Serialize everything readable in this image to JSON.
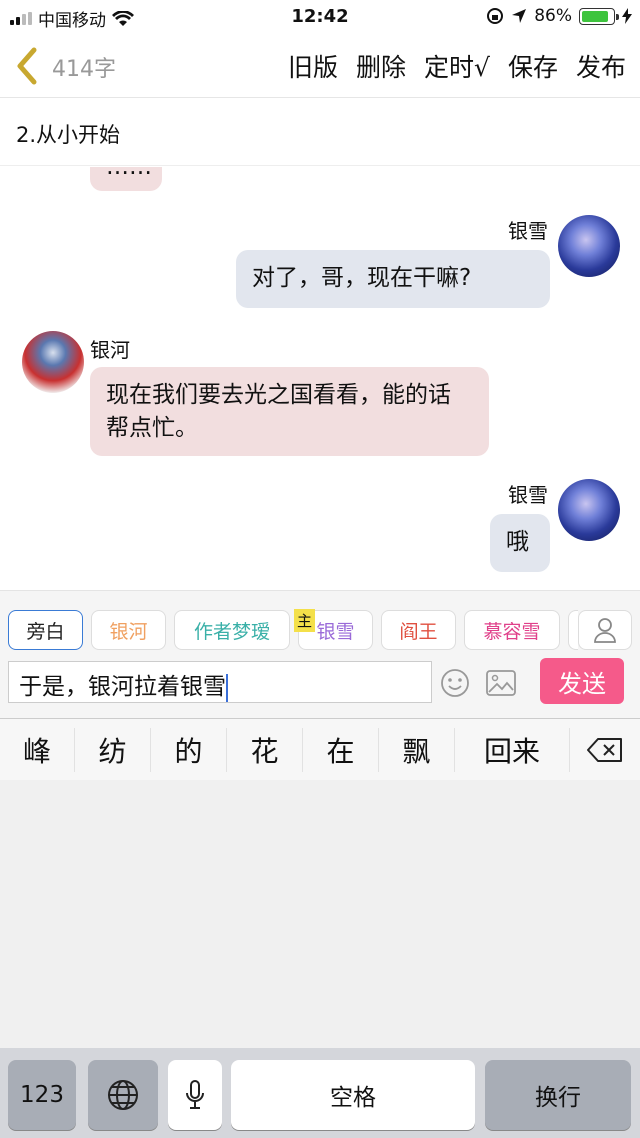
{
  "status": {
    "carrier": "中国移动",
    "time": "12:42",
    "battery": "86%",
    "battery_level": 0.86
  },
  "nav": {
    "wordcount": "414字",
    "actions": [
      "旧版",
      "删除",
      "定时√",
      "保存",
      "发布"
    ]
  },
  "chapter_title": "2.从小开始",
  "chat": [
    {
      "side": "left",
      "text": "……"
    },
    {
      "side": "right",
      "name": "银雪",
      "text": "对了，哥，现在干嘛?"
    },
    {
      "side": "left",
      "name": "银河",
      "text": "现在我们要去光之国看看，能的话帮点忙。"
    },
    {
      "side": "right",
      "name": "银雪",
      "text": "哦"
    }
  ],
  "roles": [
    {
      "label": "旁白",
      "color": "#222222"
    },
    {
      "label": "银河",
      "color": "#f0a060"
    },
    {
      "label": "作者梦瑷",
      "color": "#3ab0a8"
    },
    {
      "label": "银雪",
      "color": "#9a6ad8"
    },
    {
      "label": "阎王",
      "color": "#e05040"
    },
    {
      "label": "慕容雪",
      "color": "#e0408a"
    }
  ],
  "main_tag": "主",
  "input": {
    "value": "于是，银河拉着银雪"
  },
  "send_label": "发送",
  "candidates": [
    "峰",
    "纺",
    "的",
    "花",
    "在",
    "飘",
    "回来"
  ],
  "keys": {
    "num": "123",
    "space": "空格",
    "enter": "换行"
  }
}
